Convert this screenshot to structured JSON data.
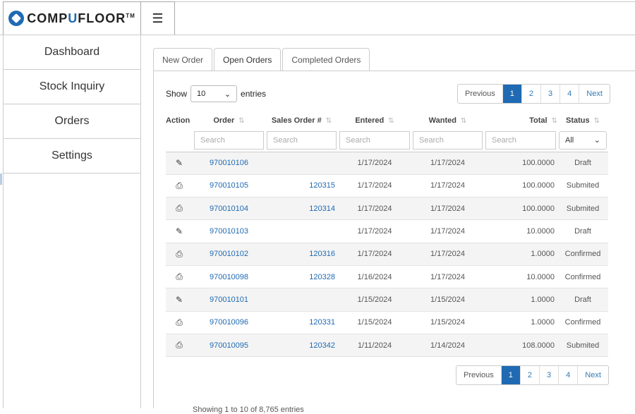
{
  "brand": {
    "name_pre": "COMP",
    "name_u": "U",
    "name_post": "FLOOR",
    "tm": "TM"
  },
  "header": {
    "menu_icon": "☰"
  },
  "sidebar": {
    "items": [
      {
        "label": "Dashboard"
      },
      {
        "label": "Stock Inquiry"
      },
      {
        "label": "Orders"
      },
      {
        "label": "Settings"
      }
    ]
  },
  "tabs": [
    {
      "label": "New Order"
    },
    {
      "label": "Open Orders",
      "active": true
    },
    {
      "label": "Completed Orders"
    }
  ],
  "length_menu": {
    "show": "Show",
    "value": "10",
    "entries": "entries"
  },
  "pagination": {
    "previous": "Previous",
    "next": "Next",
    "pages": [
      "1",
      "2",
      "3",
      "4"
    ],
    "current": "1"
  },
  "table": {
    "columns": [
      "Action",
      "Order",
      "Sales Order #",
      "Entered",
      "Wanted",
      "Total",
      "Status"
    ],
    "search_placeholder": "Search",
    "status_filter": "All",
    "rows": [
      {
        "action": "edit",
        "order": "970010106",
        "sales_order": "",
        "entered": "1/17/2024",
        "wanted": "1/17/2024",
        "total": "100.0000",
        "status": "Draft"
      },
      {
        "action": "print",
        "order": "970010105",
        "sales_order": "120315",
        "entered": "1/17/2024",
        "wanted": "1/17/2024",
        "total": "100.0000",
        "status": "Submited"
      },
      {
        "action": "print",
        "order": "970010104",
        "sales_order": "120314",
        "entered": "1/17/2024",
        "wanted": "1/17/2024",
        "total": "100.0000",
        "status": "Submited"
      },
      {
        "action": "edit",
        "order": "970010103",
        "sales_order": "",
        "entered": "1/17/2024",
        "wanted": "1/17/2024",
        "total": "10.0000",
        "status": "Draft"
      },
      {
        "action": "print",
        "order": "970010102",
        "sales_order": "120316",
        "entered": "1/17/2024",
        "wanted": "1/17/2024",
        "total": "1.0000",
        "status": "Confirmed"
      },
      {
        "action": "print",
        "order": "970010098",
        "sales_order": "120328",
        "entered": "1/16/2024",
        "wanted": "1/17/2024",
        "total": "10.0000",
        "status": "Confirmed"
      },
      {
        "action": "edit",
        "order": "970010101",
        "sales_order": "",
        "entered": "1/15/2024",
        "wanted": "1/15/2024",
        "total": "1.0000",
        "status": "Draft"
      },
      {
        "action": "print",
        "order": "970010096",
        "sales_order": "120331",
        "entered": "1/15/2024",
        "wanted": "1/15/2024",
        "total": "1.0000",
        "status": "Confirmed"
      },
      {
        "action": "print",
        "order": "970010095",
        "sales_order": "120342",
        "entered": "1/11/2024",
        "wanted": "1/14/2024",
        "total": "108.0000",
        "status": "Submited"
      }
    ]
  },
  "info": "Showing 1 to 10 of 8,765 entries",
  "icons": {
    "edit": "✎",
    "print": "⎙",
    "sort": "⇅",
    "chevron": "⌄"
  }
}
